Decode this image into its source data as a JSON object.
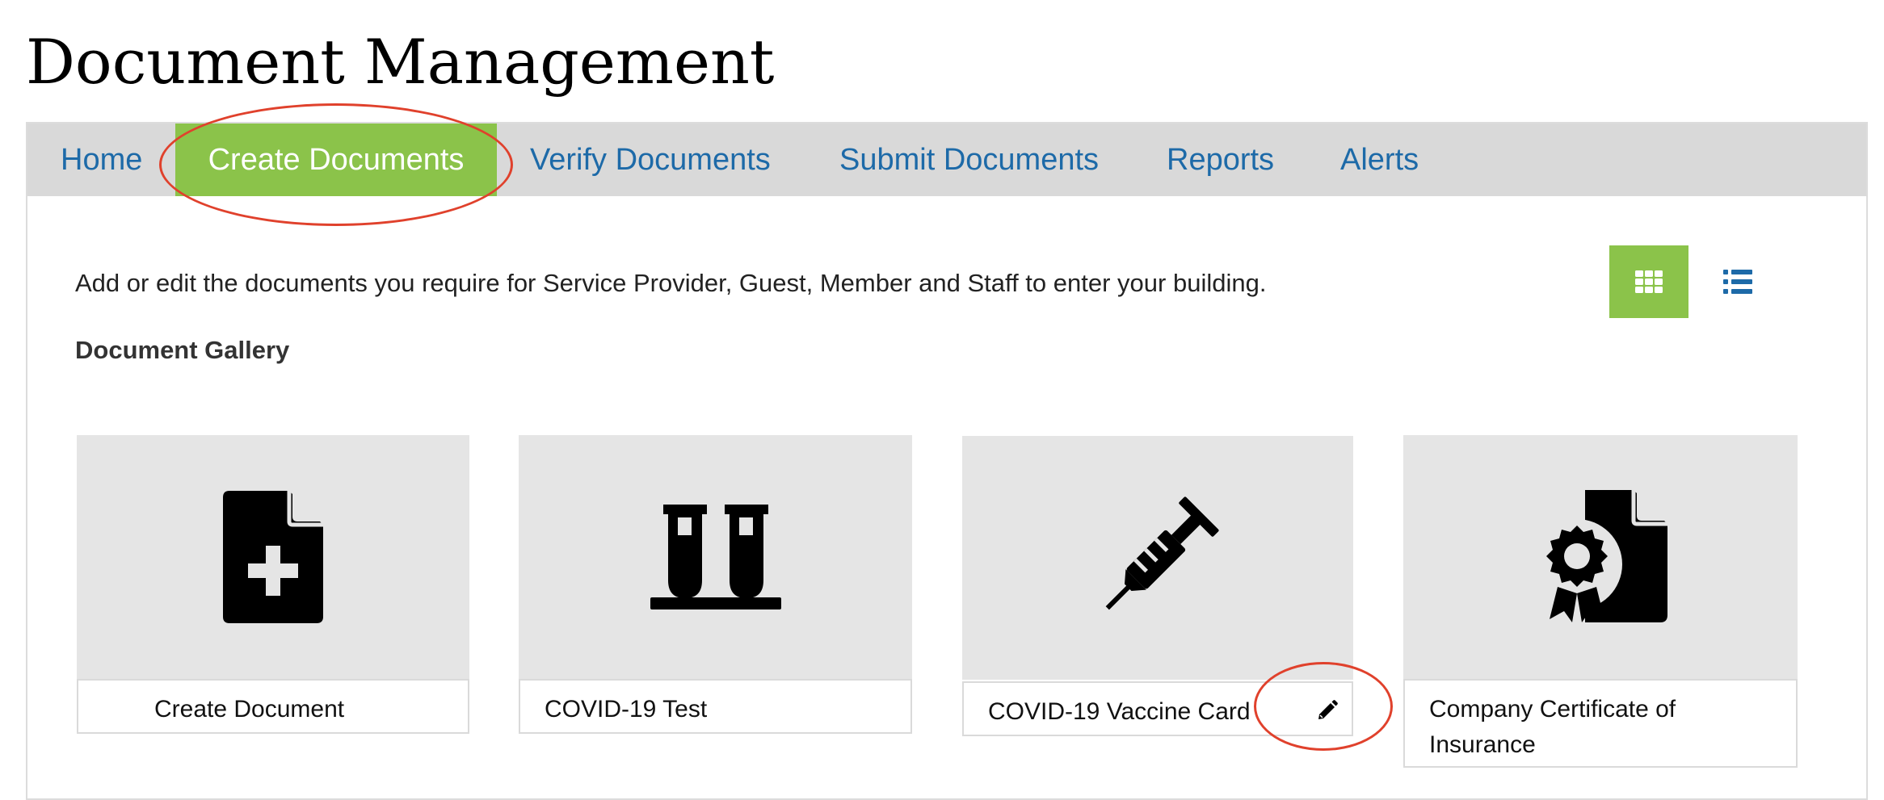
{
  "page": {
    "title": "Document Management"
  },
  "nav": {
    "items": [
      {
        "label": "Home",
        "active": false
      },
      {
        "label": "Create Documents",
        "active": true
      },
      {
        "label": "Verify Documents",
        "active": false
      },
      {
        "label": "Submit Documents",
        "active": false
      },
      {
        "label": "Reports",
        "active": false
      },
      {
        "label": "Alerts",
        "active": false
      }
    ]
  },
  "content": {
    "intro": "Add or edit the documents you require for Service Provider, Guest, Member and Staff to enter your building.",
    "gallery_heading": "Document Gallery"
  },
  "view_toggle": {
    "active": "grid",
    "options": [
      {
        "icon": "grid-icon",
        "active": true
      },
      {
        "icon": "list-icon",
        "active": false
      }
    ]
  },
  "cards": [
    {
      "label": "Create Document",
      "icon": "file-plus-icon"
    },
    {
      "label": "COVID-19 Test",
      "icon": "test-tubes-icon"
    },
    {
      "label": "COVID-19 Vaccine Card",
      "icon": "syringe-icon",
      "editable": true
    },
    {
      "label": "Company Certificate of Insurance",
      "icon": "certificate-icon"
    }
  ],
  "edit": {
    "icon": "pencil-icon"
  },
  "annotations": {
    "color": "#e0412c"
  },
  "colors": {
    "accent": "#8bc34a",
    "link": "#1d6aa8",
    "nav_bg": "#d9d9d9",
    "card_bg": "#e5e5e5"
  }
}
